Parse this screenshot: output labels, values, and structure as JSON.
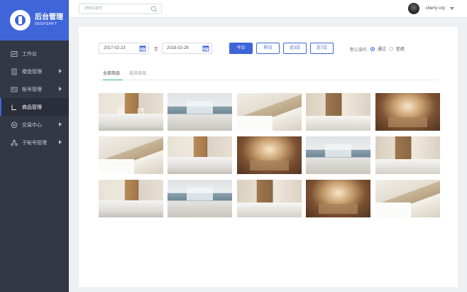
{
  "app": {
    "logo_title": "后台管理",
    "logo_subtitle": "DEEPSHFT"
  },
  "sidebar": {
    "items": [
      {
        "label": "工作台",
        "icon": "dashboard-icon",
        "has_arrow": false,
        "active": false
      },
      {
        "label": "楼盘管理",
        "icon": "building-icon",
        "has_arrow": true,
        "active": false
      },
      {
        "label": "账号管理",
        "icon": "account-icon",
        "has_arrow": true,
        "active": false
      },
      {
        "label": "商品管理",
        "icon": "product-icon",
        "has_arrow": false,
        "active": true
      },
      {
        "label": "交易中心",
        "icon": "trade-icon",
        "has_arrow": true,
        "active": false
      },
      {
        "label": "子帐号管理",
        "icon": "sub-account-icon",
        "has_arrow": true,
        "active": false
      }
    ]
  },
  "header": {
    "search_placeholder": "搜索关键字",
    "user_name": "cherry cxy"
  },
  "filters": {
    "start_date": "2017-02-23",
    "end_date": "2018-02-28",
    "separator": "至",
    "quick_buttons": [
      "今日",
      "昨日",
      "近3日",
      "近7日"
    ],
    "active_quick": "今日",
    "default_op_label": "默认操作",
    "radio_options": [
      {
        "label": "通过",
        "checked": true
      },
      {
        "label": "拒绝",
        "checked": false
      }
    ]
  },
  "tabs": [
    {
      "label": "全部商品",
      "active": true
    },
    {
      "label": "投诉商品",
      "active": false
    }
  ],
  "accent_color": "#3f66d8",
  "photos": [
    {
      "style": "room-a"
    },
    {
      "style": "room-b"
    },
    {
      "style": "room-c"
    },
    {
      "style": "room-d"
    },
    {
      "style": "room-e"
    },
    {
      "style": "room-c"
    },
    {
      "style": "room-a"
    },
    {
      "style": "room-e"
    },
    {
      "style": "room-b"
    },
    {
      "style": "room-d"
    },
    {
      "style": "room-a"
    },
    {
      "style": "room-b"
    },
    {
      "style": "room-d"
    },
    {
      "style": "room-e"
    },
    {
      "style": "room-c"
    }
  ]
}
